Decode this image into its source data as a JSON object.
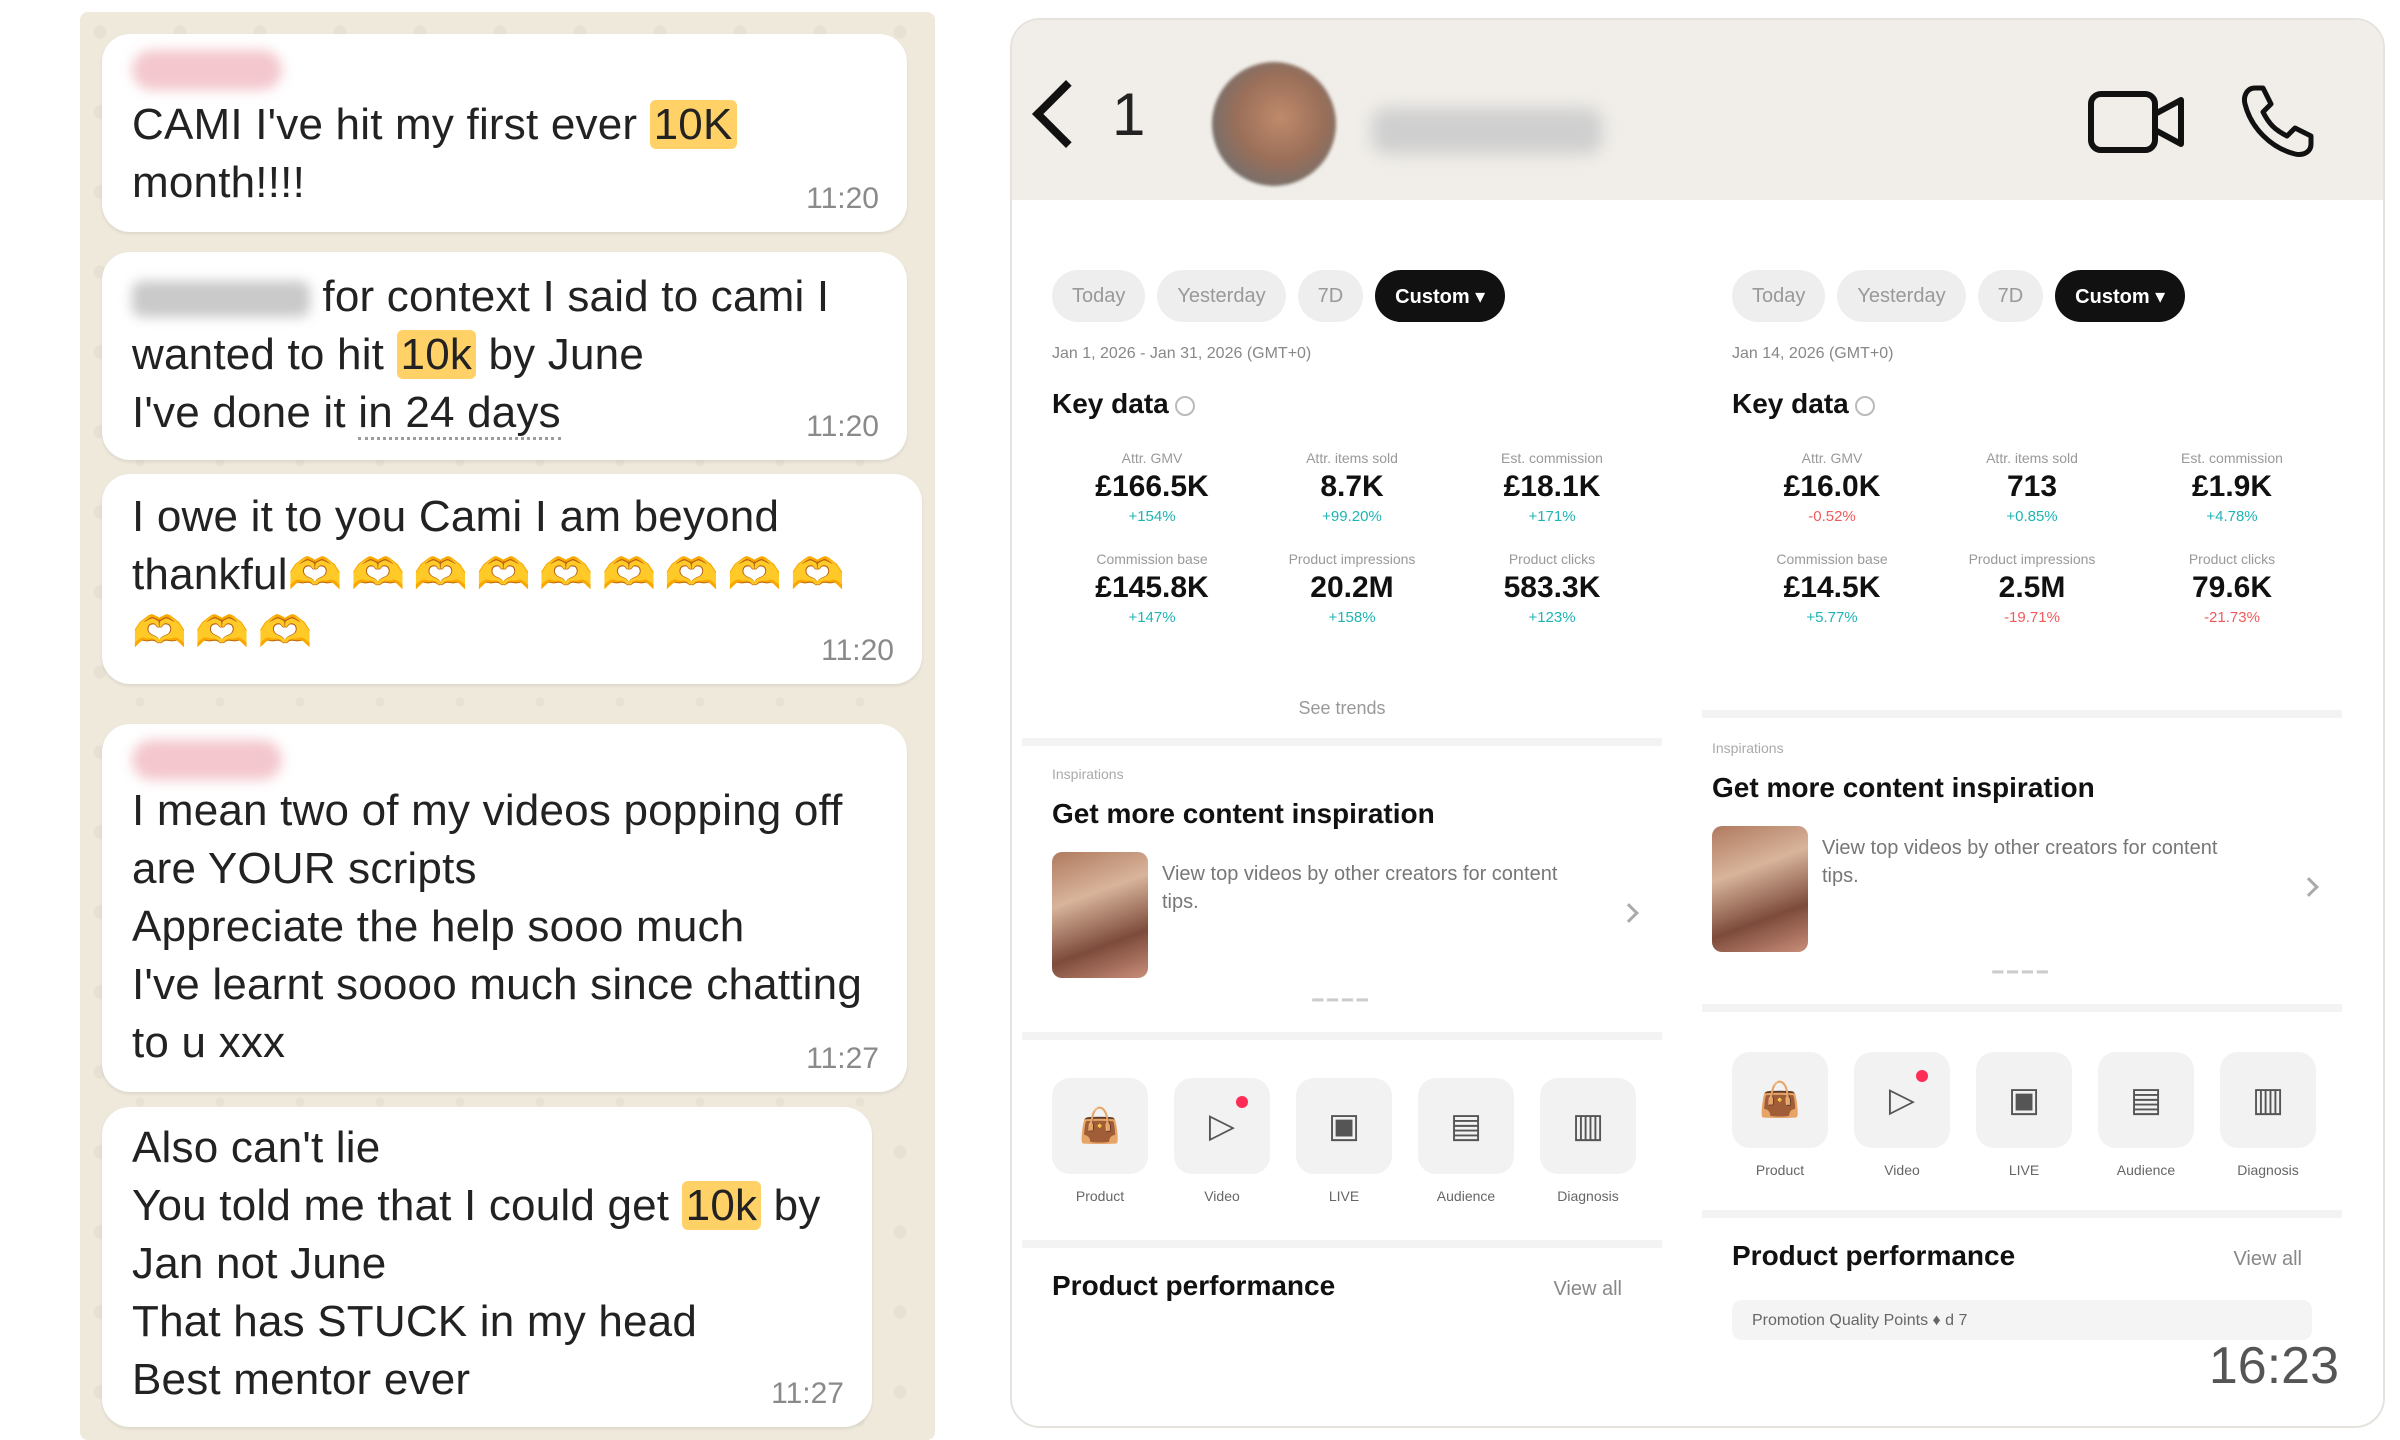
{
  "chat": {
    "messages": [
      {
        "lines": [
          "CAMI I've hit my first ever ",
          "10K",
          " month!!!!"
        ],
        "time": "11:20"
      },
      {
        "lines": [
          " for context I said to cami I",
          "wanted to hit ",
          "10k",
          " by June",
          "I've done it ",
          "in 24 days"
        ],
        "time": "11:20"
      },
      {
        "text1": "I owe it to you Cami I am beyond",
        "text2": "thankful",
        "hearts_row1": "🫶🫶🫶🫶🫶🫶🫶🫶🫶",
        "hearts_row2": "🫶🫶🫶",
        "time": "11:20"
      },
      {
        "lines": [
          "I mean two of my videos popping off",
          "are YOUR scripts",
          "Appreciate the help sooo much",
          "I've learnt soooo much since chatting",
          "to u xxx"
        ],
        "time": "11:27"
      },
      {
        "lines": [
          "Also can't lie",
          "You told me that I could get ",
          "10k",
          " by",
          "Jan not June",
          "That has STUCK in my head",
          "Best mentor ever"
        ],
        "time": "11:27"
      }
    ]
  },
  "phone": {
    "back_count": "1",
    "clock": "16:23",
    "icons": {
      "back": "chevron-left-icon",
      "video": "video-call-icon",
      "call": "phone-icon"
    },
    "dashboards": [
      {
        "filters": [
          "Today",
          "Yesterday",
          "7D",
          "Custom ▾"
        ],
        "date_range": "Jan 1, 2026 - Jan 31, 2026 (GMT+0)",
        "key_data": "Key data",
        "metrics": [
          {
            "label": "Attr. GMV",
            "value": "£166.5K",
            "delta": "+154%",
            "trend": "up"
          },
          {
            "label": "Attr. items sold",
            "value": "8.7K",
            "delta": "+99.20%",
            "trend": "up"
          },
          {
            "label": "Est. commission",
            "value": "£18.1K",
            "delta": "+171%",
            "trend": "up"
          },
          {
            "label": "Commission base",
            "value": "£145.8K",
            "delta": "+147%",
            "trend": "up"
          },
          {
            "label": "Product impressions",
            "value": "20.2M",
            "delta": "+158%",
            "trend": "up"
          },
          {
            "label": "Product clicks",
            "value": "583.3K",
            "delta": "+123%",
            "trend": "up"
          }
        ],
        "see_trends": "See trends",
        "inspiration_small": "Inspirations",
        "inspiration_title": "Get more content inspiration",
        "inspiration_desc": "View top videos by other creators for content tips.",
        "tools": [
          "Product",
          "Video",
          "LIVE",
          "Audience",
          "Diagnosis"
        ],
        "perf_title": "Product performance",
        "view_all": "View all",
        "promo": ""
      },
      {
        "filters": [
          "Today",
          "Yesterday",
          "7D",
          "Custom ▾"
        ],
        "date_range": "Jan 14, 2026 (GMT+0)",
        "key_data": "Key data",
        "metrics": [
          {
            "label": "Attr. GMV",
            "value": "£16.0K",
            "delta": "-0.52%",
            "trend": "down"
          },
          {
            "label": "Attr. items sold",
            "value": "713",
            "delta": "+0.85%",
            "trend": "up"
          },
          {
            "label": "Est. commission",
            "value": "£1.9K",
            "delta": "+4.78%",
            "trend": "up"
          },
          {
            "label": "Commission base",
            "value": "£14.5K",
            "delta": "+5.77%",
            "trend": "up"
          },
          {
            "label": "Product impressions",
            "value": "2.5M",
            "delta": "-19.71%",
            "trend": "down"
          },
          {
            "label": "Product clicks",
            "value": "79.6K",
            "delta": "-21.73%",
            "trend": "down"
          }
        ],
        "see_trends": "",
        "inspiration_small": "Inspirations",
        "inspiration_title": "Get more content inspiration",
        "inspiration_desc": "View top videos by other creators for content tips.",
        "tools": [
          "Product",
          "Video",
          "LIVE",
          "Audience",
          "Diagnosis"
        ],
        "perf_title": "Product performance",
        "view_all": "View all",
        "promo": "Promotion Quality Points  ♦ d 7"
      }
    ]
  }
}
